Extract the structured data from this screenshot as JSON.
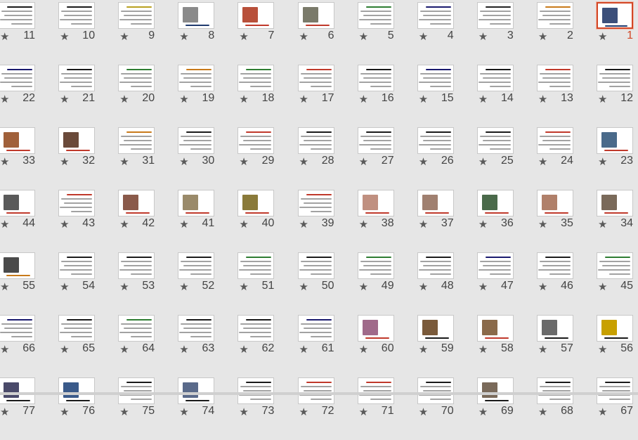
{
  "app": {
    "view": "Slide Sorter"
  },
  "selected_slide": "1",
  "accent_color": "#d24726",
  "slides": [
    {
      "num": "1",
      "title": "",
      "pic": "#3c4f7a",
      "line": "#1f3a6e"
    },
    {
      "num": "2",
      "title": "",
      "pic": "",
      "line": "#c87a1a"
    },
    {
      "num": "3",
      "title": "",
      "pic": "",
      "line": "#222222"
    },
    {
      "num": "4",
      "title": "",
      "pic": "",
      "line": "#1a1a6e"
    },
    {
      "num": "5",
      "title": "",
      "pic": "",
      "line": "#2e7d32"
    },
    {
      "num": "6",
      "title": "",
      "pic": "#7a7a6a",
      "line": "#c0392b"
    },
    {
      "num": "7",
      "title": "",
      "pic": "#b8503a",
      "line": "#c0392b"
    },
    {
      "num": "8",
      "title": "",
      "pic": "#8a8a8a",
      "line": "#1f3a6e"
    },
    {
      "num": "9",
      "title": "",
      "pic": "",
      "line": "#b8a020"
    },
    {
      "num": "10",
      "title": "",
      "pic": "",
      "line": "#1a1a1a"
    },
    {
      "num": "11",
      "title": "",
      "pic": "",
      "line": "#1a1a1a"
    },
    {
      "num": "12",
      "title": "",
      "pic": "",
      "line": "#1a1a1a"
    },
    {
      "num": "13",
      "title": "",
      "pic": "",
      "line": "#c0392b"
    },
    {
      "num": "14",
      "title": "",
      "pic": "",
      "line": "#1a1a1a"
    },
    {
      "num": "15",
      "title": "",
      "pic": "",
      "line": "#1a1a6e"
    },
    {
      "num": "16",
      "title": "",
      "pic": "",
      "line": "#1a1a1a"
    },
    {
      "num": "17",
      "title": "",
      "pic": "",
      "line": "#c0392b"
    },
    {
      "num": "18",
      "title": "",
      "pic": "",
      "line": "#2e7d32"
    },
    {
      "num": "19",
      "title": "",
      "pic": "",
      "line": "#c87a1a"
    },
    {
      "num": "20",
      "title": "",
      "pic": "",
      "line": "#2e7d32"
    },
    {
      "num": "21",
      "title": "",
      "pic": "",
      "line": "#1a1a1a"
    },
    {
      "num": "22",
      "title": "",
      "pic": "",
      "line": "#1a1a6e"
    },
    {
      "num": "23",
      "title": "",
      "pic": "#4a6a8a",
      "line": "#c0392b"
    },
    {
      "num": "24",
      "title": "",
      "pic": "",
      "line": "#c0392b"
    },
    {
      "num": "25",
      "title": "",
      "pic": "",
      "line": "#1a1a1a"
    },
    {
      "num": "26",
      "title": "",
      "pic": "",
      "line": "#1a1a1a"
    },
    {
      "num": "27",
      "title": "",
      "pic": "",
      "line": "#1a1a1a"
    },
    {
      "num": "28",
      "title": "",
      "pic": "",
      "line": "#1a1a1a"
    },
    {
      "num": "29",
      "title": "",
      "pic": "",
      "line": "#c0392b"
    },
    {
      "num": "30",
      "title": "",
      "pic": "",
      "line": "#1a1a1a"
    },
    {
      "num": "31",
      "title": "",
      "pic": "",
      "line": "#c87a1a"
    },
    {
      "num": "32",
      "title": "",
      "pic": "#6a4a3a",
      "line": "#c0392b"
    },
    {
      "num": "33",
      "title": "",
      "pic": "#a0603a",
      "line": "#c0392b"
    },
    {
      "num": "34",
      "title": "",
      "pic": "#7a6a5a",
      "line": "#c0392b"
    },
    {
      "num": "35",
      "title": "",
      "pic": "#b0806a",
      "line": "#c0392b"
    },
    {
      "num": "36",
      "title": "",
      "pic": "#4a6a4a",
      "line": "#c0392b"
    },
    {
      "num": "37",
      "title": "",
      "pic": "#a08070",
      "line": "#c0392b"
    },
    {
      "num": "38",
      "title": "",
      "pic": "#c09080",
      "line": "#c0392b"
    },
    {
      "num": "39",
      "title": "",
      "pic": "",
      "line": "#c0392b"
    },
    {
      "num": "40",
      "title": "",
      "pic": "#8a7a3a",
      "line": "#c0392b"
    },
    {
      "num": "41",
      "title": "",
      "pic": "#9a8a6a",
      "line": "#c0392b"
    },
    {
      "num": "42",
      "title": "",
      "pic": "#8a5a4a",
      "line": "#c0392b"
    },
    {
      "num": "43",
      "title": "",
      "pic": "",
      "line": "#c0392b"
    },
    {
      "num": "44",
      "title": "",
      "pic": "#5a5a5a",
      "line": "#c0392b"
    },
    {
      "num": "45",
      "title": "",
      "pic": "",
      "line": "#2e7d32"
    },
    {
      "num": "46",
      "title": "",
      "pic": "",
      "line": "#1a1a1a"
    },
    {
      "num": "47",
      "title": "",
      "pic": "",
      "line": "#1a1a6e"
    },
    {
      "num": "48",
      "title": "",
      "pic": "",
      "line": "#1a1a1a"
    },
    {
      "num": "49",
      "title": "",
      "pic": "",
      "line": "#2e7d32"
    },
    {
      "num": "50",
      "title": "",
      "pic": "",
      "line": "#1a1a1a"
    },
    {
      "num": "51",
      "title": "",
      "pic": "",
      "line": "#2e7d32"
    },
    {
      "num": "52",
      "title": "",
      "pic": "",
      "line": "#1a1a1a"
    },
    {
      "num": "53",
      "title": "",
      "pic": "",
      "line": "#1a1a1a"
    },
    {
      "num": "54",
      "title": "",
      "pic": "",
      "line": "#1a1a1a"
    },
    {
      "num": "55",
      "title": "",
      "pic": "#4a4a4a",
      "line": "#c87a1a"
    },
    {
      "num": "56",
      "title": "",
      "pic": "#c8a000",
      "line": "#1a1a1a"
    },
    {
      "num": "57",
      "title": "",
      "pic": "#6a6a6a",
      "line": "#1a1a1a"
    },
    {
      "num": "58",
      "title": "",
      "pic": "#8a6a4a",
      "line": "#c0392b"
    },
    {
      "num": "59",
      "title": "",
      "pic": "#7a5a3a",
      "line": "#1a1a1a"
    },
    {
      "num": "60",
      "title": "",
      "pic": "#a06a8a",
      "line": "#c0392b"
    },
    {
      "num": "61",
      "title": "",
      "pic": "",
      "line": "#1a1a6e"
    },
    {
      "num": "62",
      "title": "",
      "pic": "",
      "line": "#1a1a1a"
    },
    {
      "num": "63",
      "title": "",
      "pic": "",
      "line": "#1a1a1a"
    },
    {
      "num": "64",
      "title": "",
      "pic": "",
      "line": "#2e7d32"
    },
    {
      "num": "65",
      "title": "",
      "pic": "",
      "line": "#1a1a1a"
    },
    {
      "num": "66",
      "title": "",
      "pic": "",
      "line": "#1a1a6e"
    },
    {
      "num": "67",
      "title": "",
      "pic": "",
      "line": "#1a1a1a"
    },
    {
      "num": "68",
      "title": "",
      "pic": "",
      "line": "#1a1a1a"
    },
    {
      "num": "69",
      "title": "",
      "pic": "#7a6a5a",
      "line": "#1a1a1a"
    },
    {
      "num": "70",
      "title": "",
      "pic": "",
      "line": "#1a1a1a"
    },
    {
      "num": "71",
      "title": "",
      "pic": "",
      "line": "#c0392b"
    },
    {
      "num": "72",
      "title": "",
      "pic": "",
      "line": "#c0392b"
    },
    {
      "num": "73",
      "title": "",
      "pic": "",
      "line": "#1a1a1a"
    },
    {
      "num": "74",
      "title": "",
      "pic": "#5a6a8a",
      "line": "#1a1a1a"
    },
    {
      "num": "75",
      "title": "",
      "pic": "",
      "line": "#1a1a1a"
    },
    {
      "num": "76",
      "title": "",
      "pic": "#3a5a8a",
      "line": "#1a1a1a"
    },
    {
      "num": "77",
      "title": "",
      "pic": "#4a4a6a",
      "line": "#1a1a1a"
    }
  ],
  "star_glyph": "★"
}
